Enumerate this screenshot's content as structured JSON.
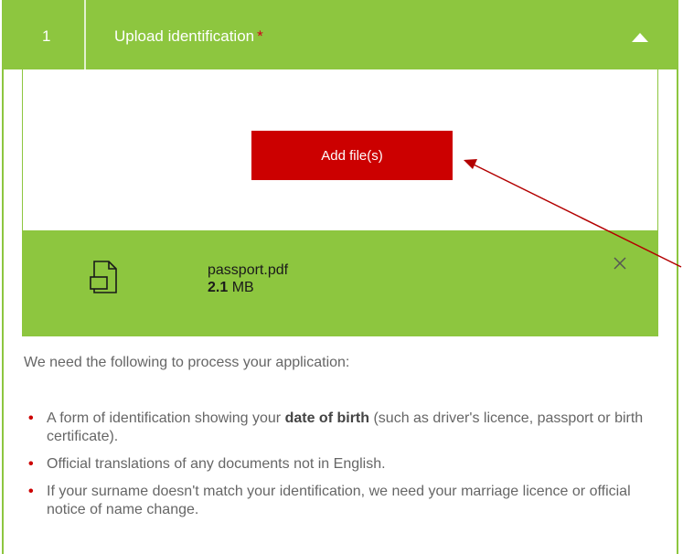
{
  "section": {
    "step_number": "1",
    "title": "Upload identification",
    "required_marker": "*",
    "collapse_icon": "chevron-up-icon"
  },
  "upload": {
    "add_button_label": "Add file(s)"
  },
  "file": {
    "name": "passport.pdf",
    "size_value": "2.1",
    "size_unit": "MB",
    "icon": "document-icon",
    "remove_icon": "close-icon"
  },
  "info": {
    "intro": "We need the following to process your application:",
    "items": [
      {
        "before": "A form of identification showing your ",
        "bold": "date of birth",
        "after": " (such as driver's licence, passport or birth certificate)."
      },
      {
        "before": "Official translations of any documents not in English.",
        "bold": "",
        "after": ""
      },
      {
        "before": "If your surname doesn't match your identification, we need your marriage licence or official notice of name change.",
        "bold": "",
        "after": ""
      }
    ],
    "bullet": "•"
  },
  "colors": {
    "header_green": "#8dc63f",
    "button_red": "#cc0000",
    "required_red": "#d0021b",
    "annotation_arrow": "#b30000"
  }
}
